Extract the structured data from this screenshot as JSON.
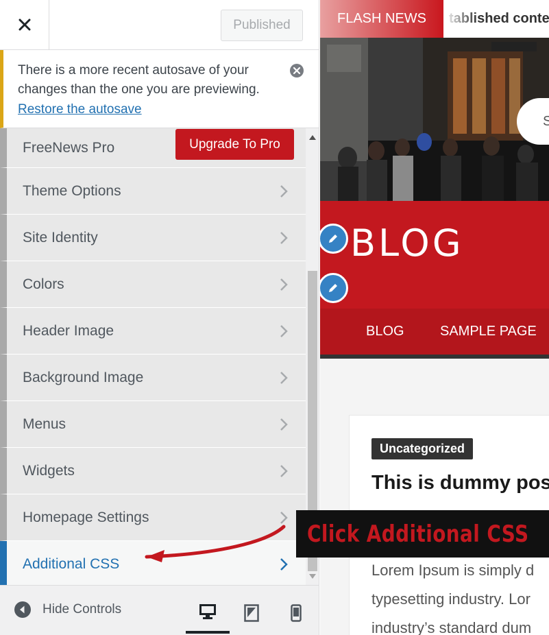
{
  "topbar": {
    "close_label": "×",
    "publish_label": "Published"
  },
  "notice": {
    "text": "There is a more recent autosave of your changes than the one you are previewing.",
    "link": "Restore the autosave"
  },
  "pro": {
    "label": "FreeNews Pro",
    "upgrade_label": "Upgrade To Pro"
  },
  "panels": [
    {
      "label": "Theme Options"
    },
    {
      "label": "Site Identity"
    },
    {
      "label": "Colors"
    },
    {
      "label": "Header Image"
    },
    {
      "label": "Background Image"
    },
    {
      "label": "Menus"
    },
    {
      "label": "Widgets"
    },
    {
      "label": "Homepage Settings"
    },
    {
      "label": "Additional CSS",
      "active": true
    }
  ],
  "footer": {
    "hide_controls": "Hide Controls",
    "devices": [
      "desktop",
      "tablet",
      "mobile"
    ],
    "active_device": "desktop"
  },
  "preview": {
    "flash_label": "FLASH NEWS",
    "ticker": "tablished conte",
    "search_letter": "S",
    "site_title": "BLOG",
    "nav": [
      "BLOG",
      "SAMPLE PAGE"
    ],
    "post": {
      "category": "Uncategorized",
      "title": "This is dummy pos",
      "excerpt": [
        "Lorem Ipsum is simply d",
        "typesetting industry. Lor",
        "industry’s standard dum"
      ]
    }
  },
  "annotation": {
    "text": "Click Additional CSS"
  },
  "colors": {
    "brand_red": "#c3181f",
    "wp_blue": "#2271b1",
    "notice_yellow": "#dba617"
  },
  "icons": [
    "close-icon",
    "dismiss-icon",
    "chevron-right-icon",
    "hide-controls-icon",
    "desktop-icon",
    "tablet-icon",
    "mobile-icon",
    "pencil-icon"
  ]
}
